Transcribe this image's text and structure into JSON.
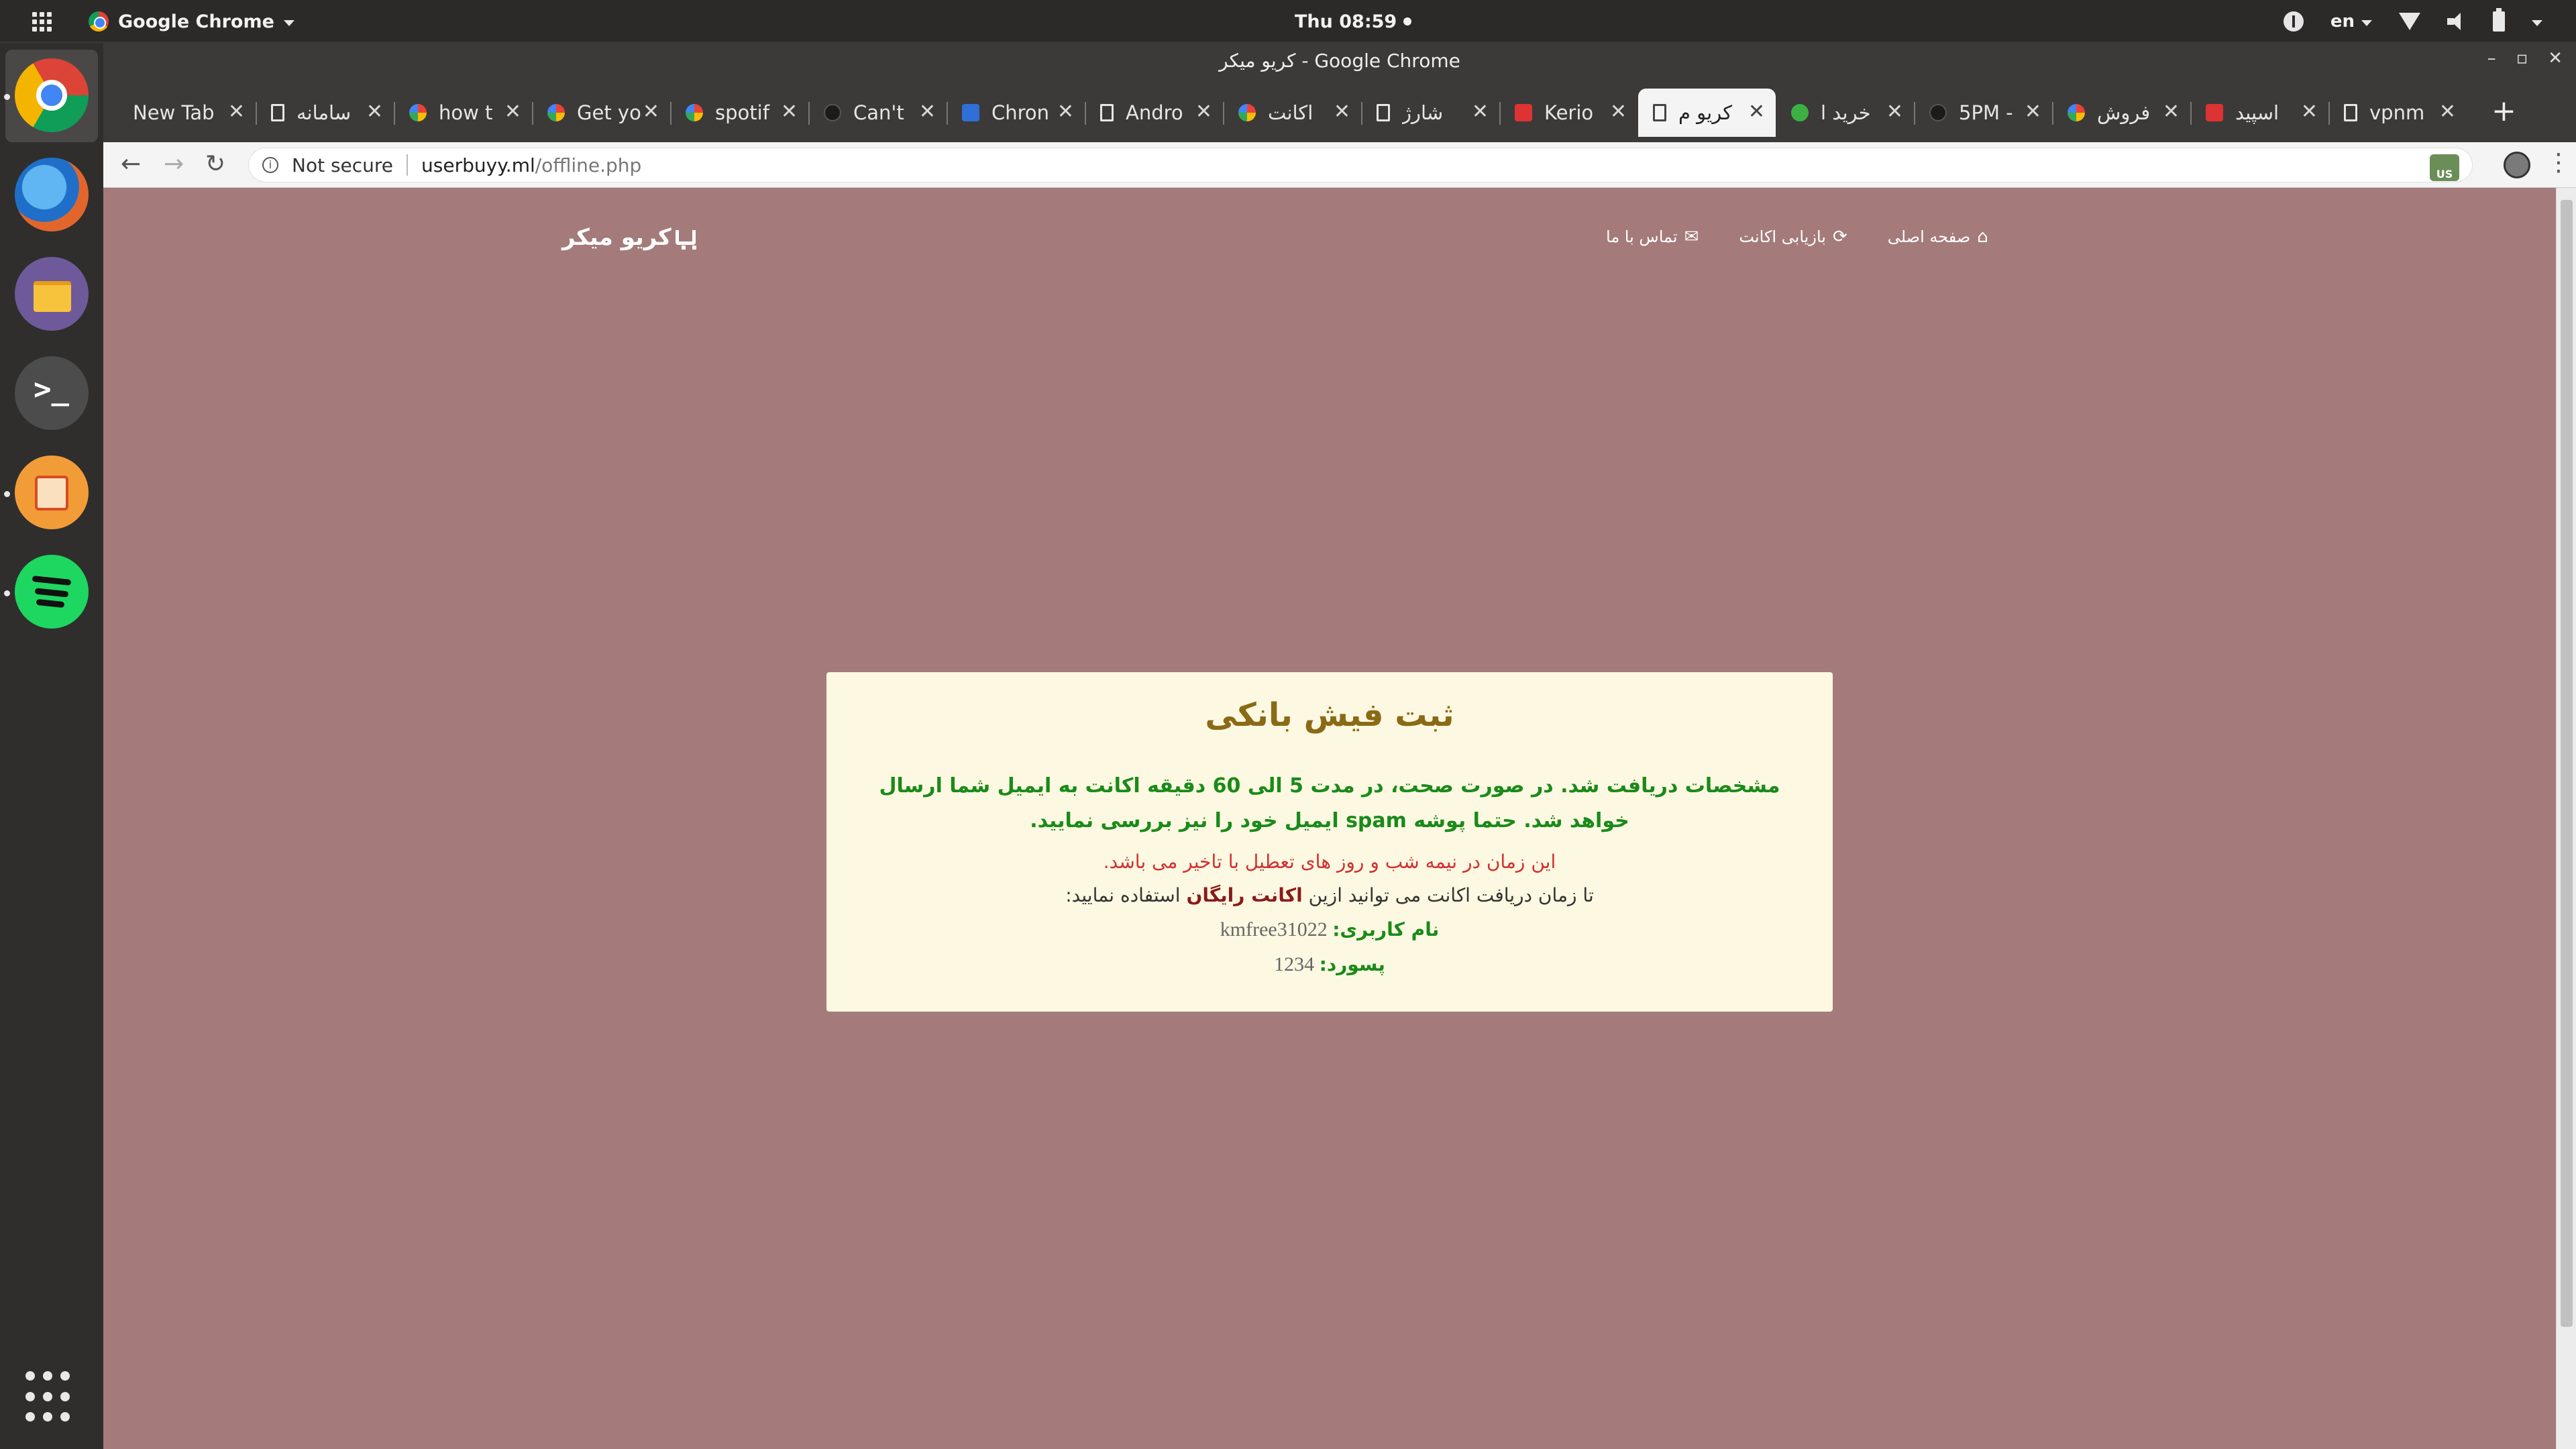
{
  "topbar": {
    "app_name": "Google Chrome",
    "clock": "Thu 08:59",
    "lang": "en"
  },
  "window": {
    "title": "کریو میکر - Google Chrome",
    "controls": [
      "–",
      "▫",
      "✕"
    ]
  },
  "tabs": [
    {
      "label": "New Tab",
      "icon": "none-icon"
    },
    {
      "label": "سامانه",
      "icon": "doc-icon"
    },
    {
      "label": "how t",
      "icon": "google-icon"
    },
    {
      "label": "Get yo",
      "icon": "google-icon"
    },
    {
      "label": "spotif",
      "icon": "google-icon"
    },
    {
      "label": "Can't",
      "icon": "github-icon"
    },
    {
      "label": "Chron",
      "icon": "chat-icon"
    },
    {
      "label": "Andro",
      "icon": "doc-icon"
    },
    {
      "label": "اکانت",
      "icon": "google-icon"
    },
    {
      "label": "شارژ",
      "icon": "doc-icon"
    },
    {
      "label": "Kerio",
      "icon": "kerio-icon"
    },
    {
      "label": "کریو م",
      "icon": "doc-icon"
    },
    {
      "label": "خرید ا",
      "icon": "green-icon"
    },
    {
      "label": "5PM -",
      "icon": "github-icon"
    },
    {
      "label": "فروش",
      "icon": "google-icon"
    },
    {
      "label": "اسپید",
      "icon": "sp-icon"
    },
    {
      "label": "vpnm",
      "icon": "doc-icon"
    }
  ],
  "active_tab_index": 11,
  "close_glyph": "✕",
  "newtab_glyph": "+",
  "toolbar": {
    "back": "←",
    "forward": "→",
    "reload": "↻",
    "security": "Not secure",
    "url_host": "userbuyy.ml",
    "url_path": "/offline.php",
    "star": "☆",
    "ext_label": "US",
    "menu": "⋮"
  },
  "site": {
    "brand": "کریو میکر",
    "nav": [
      {
        "label": "صفحه اصلی",
        "icon": "home-icon",
        "glyph": "⌂"
      },
      {
        "label": "بازیابی اکانت",
        "icon": "refresh-icon",
        "glyph": "⟳"
      },
      {
        "label": "تماس با ما",
        "icon": "envelope-icon",
        "glyph": "✉"
      }
    ],
    "card": {
      "title": "ثبت فیش بانکی",
      "p1": "مشخصات دریافت شد. در صورت صحت، در مدت 5 الی 60 دقیقه اکانت به ایمیل شما ارسال خواهد شد. حتما پوشه spam ایمیل خود را نیز بررسی نمایید.",
      "p2": "این زمان در نیمه شب و روز های تعطیل با تاخیر می باشد.",
      "p3_before": "تا زمان دریافت اکانت می توانید ازین ",
      "p3_bold": "اکانت رایگان",
      "p3_after": " استفاده نمایید:",
      "username_label": "نام کاربری:",
      "username": "kmfree31022",
      "password_label": "پسورد:",
      "password": "1234"
    }
  }
}
